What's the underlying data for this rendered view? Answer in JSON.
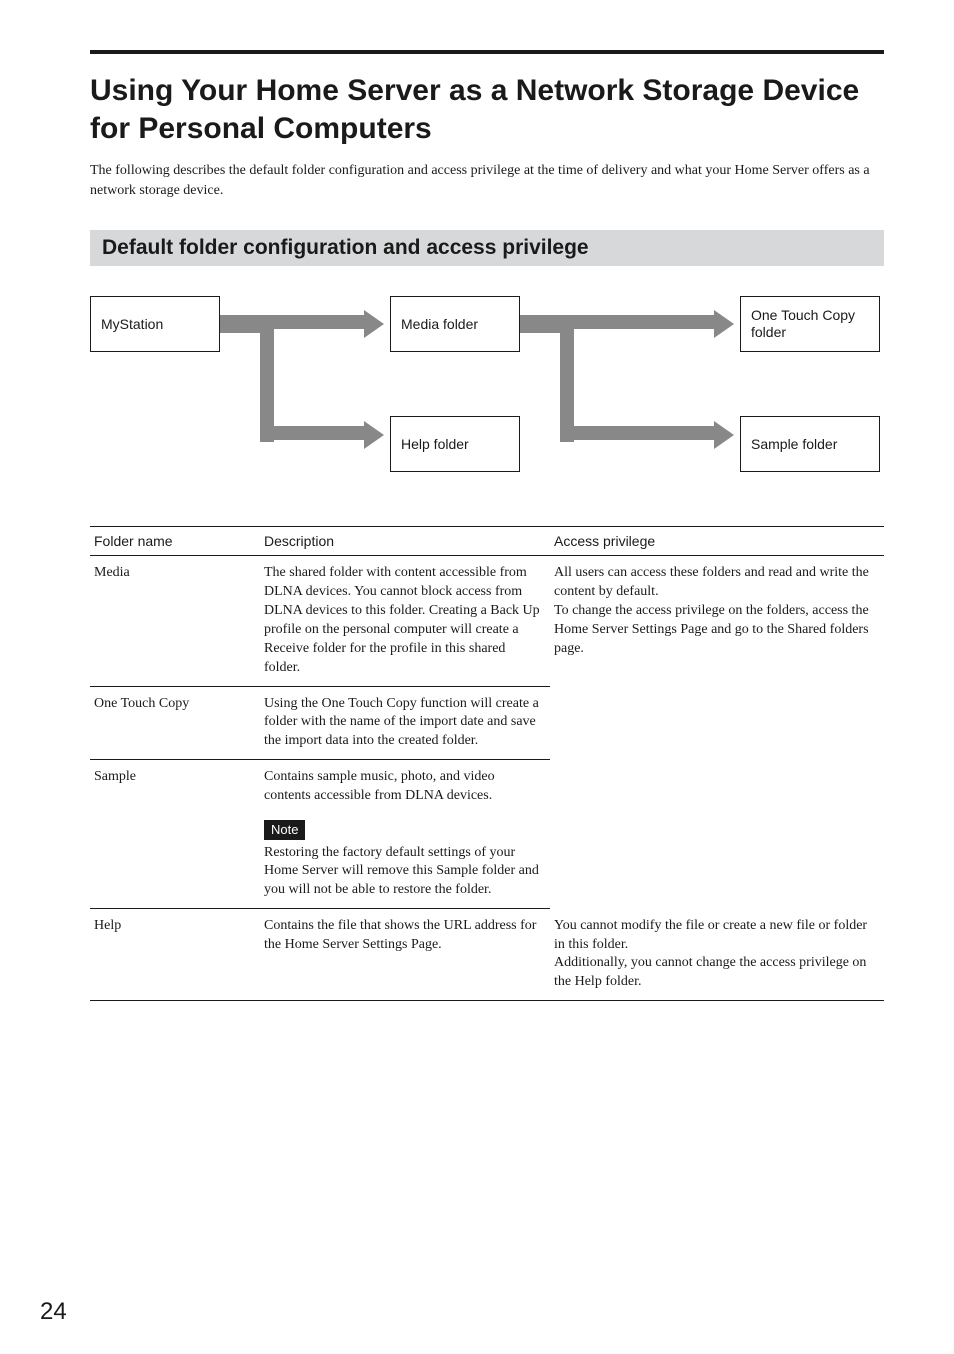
{
  "page_number": "24",
  "heading": "Using Your Home Server as a Network Storage Device for Personal Computers",
  "intro": "The following describes the default folder configuration and access privilege at the time of delivery and what your Home Server offers as a network storage device.",
  "section_head": "Default folder configuration and access privilege",
  "diagram": {
    "mystation": "MyStation",
    "media": "Media folder",
    "help": "Help folder",
    "onetouch": "One Touch Copy folder",
    "sample": "Sample folder"
  },
  "table": {
    "headers": {
      "c1": "Folder name",
      "c2": "Description",
      "c3": "Access privilege"
    },
    "rows": {
      "media": {
        "name": "Media",
        "desc": "The shared folder with content accessible from DLNA devices. You cannot block access from DLNA devices to this folder. Creating a Back Up profile on the personal computer will create a Receive folder for the profile in this shared folder.",
        "access": "All users can access these folders and read and write the content by default.\nTo change the access privilege on the folders, access the Home Server Settings Page and go to the Shared folders page."
      },
      "onetouch": {
        "name": "One Touch Copy",
        "desc": "Using the One Touch Copy function will create a folder with the name of the import date and save the import data into the created folder."
      },
      "sample": {
        "name": "Sample",
        "desc1": "Contains sample music, photo, and video contents accessible from DLNA devices.",
        "note_label": "Note",
        "desc2": "Restoring the factory default settings of your Home Server will remove this Sample folder and you will not be able to restore the folder."
      },
      "help": {
        "name": "Help",
        "desc": "Contains the file that shows the URL address for the Home Server Settings Page.",
        "access": "You cannot modify the file or create a new file or folder in this folder.\nAdditionally, you cannot change the access privilege on the Help folder."
      }
    }
  }
}
